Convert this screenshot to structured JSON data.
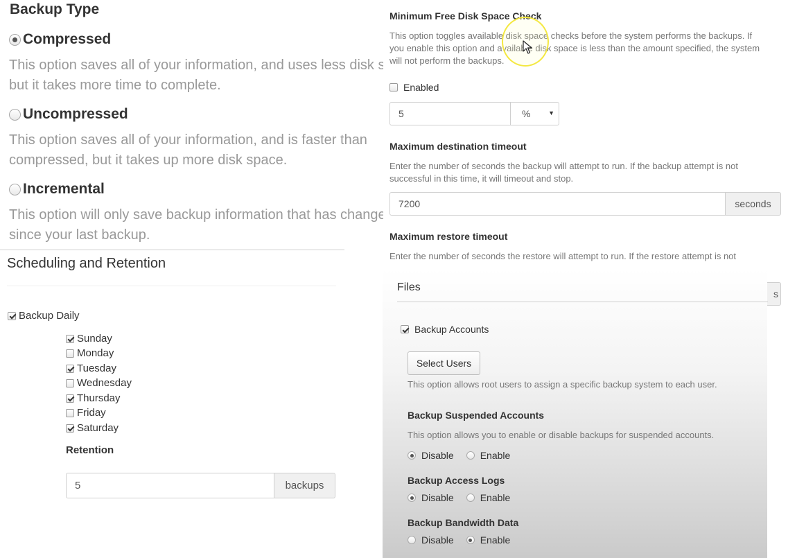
{
  "backup_type": {
    "title": "Backup Type",
    "options": [
      {
        "label": "Compressed",
        "checked": true,
        "desc_line1": "This option saves all of your information, and uses less disk space,",
        "desc_line2": "but it takes more time to complete."
      },
      {
        "label": "Uncompressed",
        "checked": false,
        "desc_line1": "This option saves all of your information, and is faster than",
        "desc_line2": "compressed, but it takes up more disk space."
      },
      {
        "label": "Incremental",
        "checked": false,
        "desc_line1": "This option will only save backup information that has changed",
        "desc_line2": "since your last backup."
      }
    ]
  },
  "scheduling": {
    "title": "Scheduling and Retention",
    "daily_label": "Backup Daily",
    "daily_checked": true,
    "days": [
      {
        "label": "Sunday",
        "checked": true
      },
      {
        "label": "Monday",
        "checked": false
      },
      {
        "label": "Tuesday",
        "checked": true
      },
      {
        "label": "Wednesday",
        "checked": false
      },
      {
        "label": "Thursday",
        "checked": true
      },
      {
        "label": "Friday",
        "checked": false
      },
      {
        "label": "Saturday",
        "checked": true
      }
    ],
    "retention_label": "Retention",
    "retention_value": "5",
    "retention_unit": "backups"
  },
  "disk_check": {
    "title": "Minimum Free Disk Space Check",
    "desc_line1": "This option toggles available disk space checks before the system performs the backups. If",
    "desc_line2": "you enable this option and available disk space is less than the amount specified, the system",
    "desc_line3": "will not perform the backups.",
    "enabled_label": "Enabled",
    "enabled_checked": false,
    "value": "5",
    "unit_selected": "%"
  },
  "dest_timeout": {
    "title": "Maximum destination timeout",
    "desc_line1": "Enter the number of seconds the backup will attempt to run. If the backup attempt is not",
    "desc_line2": "successful in this time, it will timeout and stop.",
    "value": "7200",
    "unit": "seconds"
  },
  "restore_timeout": {
    "title": "Maximum restore timeout",
    "desc_line1": "Enter the number of seconds the restore will attempt to run. If the restore attempt is not",
    "button_edge": "s"
  },
  "files": {
    "title": "Files",
    "backup_accounts_label": "Backup Accounts",
    "backup_accounts_checked": true,
    "select_users_label": "Select Users",
    "select_users_desc": "This option allows root users to assign a specific backup system to each user.",
    "suspended": {
      "title": "Backup Suspended Accounts",
      "desc": "This option allows you to enable or disable backups for suspended accounts.",
      "disable_label": "Disable",
      "enable_label": "Enable",
      "selected": "disable"
    },
    "access_logs": {
      "title": "Backup Access Logs",
      "disable_label": "Disable",
      "enable_label": "Enable",
      "selected": "disable"
    },
    "bandwidth": {
      "title": "Backup Bandwidth Data",
      "disable_label": "Disable",
      "enable_label": "Enable",
      "selected": "enable"
    }
  }
}
